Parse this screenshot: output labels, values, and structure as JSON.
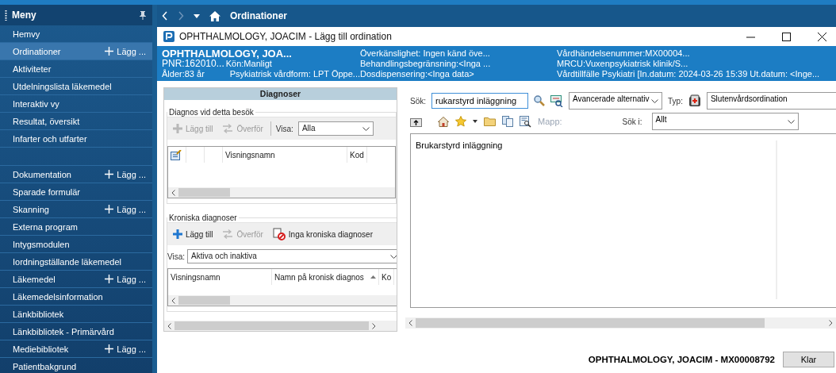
{
  "sidebar": {
    "title": "Meny",
    "groups": [
      [
        {
          "label": "Hemvy",
          "selected": false
        },
        {
          "label": "Ordinationer",
          "selected": true,
          "add_label": "Lägg ..."
        },
        {
          "label": "Aktiviteter",
          "selected": false
        },
        {
          "label": "Utdelningslista läkemedel",
          "selected": false
        },
        {
          "label": "Interaktiv vy",
          "selected": false
        },
        {
          "label": "Resultat, översikt",
          "selected": false
        },
        {
          "label": "Infarter och utfarter",
          "selected": false
        }
      ],
      [
        {
          "label": "Dokumentation",
          "selected": false,
          "add_label": "Lägg ..."
        },
        {
          "label": "Sparade formulär",
          "selected": false
        },
        {
          "label": "Skanning",
          "selected": false,
          "add_label": "Lägg ..."
        },
        {
          "label": "Externa program",
          "selected": false
        },
        {
          "label": "Intygsmodulen",
          "selected": false
        },
        {
          "label": "Iordningställande läkemedel",
          "selected": false
        },
        {
          "label": "Läkemedel",
          "selected": false,
          "add_label": "Lägg ..."
        },
        {
          "label": "Läkemedelsinformation",
          "selected": false
        },
        {
          "label": "Länkbibliotek",
          "selected": false
        },
        {
          "label": "Länkbibliotek - Primärvård",
          "selected": false
        },
        {
          "label": "Mediebibliotek",
          "selected": false,
          "add_label": "Lägg ..."
        },
        {
          "label": "Patientbakgrund",
          "selected": false
        }
      ]
    ]
  },
  "nav": {
    "title": "Ordinationer"
  },
  "dialog": {
    "title": "OPHTHALMOLOGY, JOACIM - Lägg till ordination",
    "patient": {
      "name": "OPHTHALMOLOGY, JOA...",
      "pnr": "PNR:162010...",
      "gender": "Kön:Manligt",
      "age": "Ålder:83 år",
      "care_form": "Psykiatrisk vårdform: LPT Öppe...",
      "allergy": "Överkänslighet: Ingen känd öve...",
      "treatment_limit": "Behandlingsbegränsning:<Inga ...",
      "dose_dispensing": "Dosdispensering:<Inga data>",
      "event_number": "Vårdhändelsenummer:MX00004...",
      "mrcu": "MRCU:Vuxenpsykiatrisk klinik/S...",
      "care_episode": "Vårdtillfälle Psykiatri [In.datum: 2024-03-26 15:39 Ut.datum: <Inge..."
    },
    "diagnoses": {
      "title": "Diagnoser",
      "visit": {
        "legend": "Diagnos vid detta besök",
        "tools": [
          {
            "label": "Lägg till",
            "kind": "add",
            "disabled": true
          },
          {
            "label": "Överför",
            "kind": "transfer",
            "disabled": true
          }
        ],
        "show_label": "Visa:",
        "show_value": "Alla",
        "columns": [
          {
            "label": "Visningsnamn",
            "sorted": false
          },
          {
            "label": "Kod",
            "sorted": false
          }
        ]
      },
      "chronic": {
        "legend": "Kroniska diagnoser",
        "tools": [
          {
            "label": "Lägg till",
            "kind": "add",
            "disabled": false
          },
          {
            "label": "Överför",
            "kind": "transfer",
            "disabled": true
          },
          {
            "label": "Inga kroniska diagnoser",
            "kind": "none",
            "disabled": false
          }
        ],
        "show_label": "Visa:",
        "show_value": "Aktiva och inaktiva",
        "columns": [
          {
            "label": "Visningsnamn",
            "sorted": false
          },
          {
            "label": "Namn på kronisk diagnos",
            "sorted": true
          },
          {
            "label": "Ko",
            "sorted": false
          }
        ]
      }
    },
    "search": {
      "label": "Sök:",
      "value": "rukarstyrd inläggning",
      "advanced": "Avancerade alternativ",
      "type_label": "Typ:",
      "type_value": "Slutenvårdsordination",
      "folder_label": "Mapp:",
      "search_in_label": "Sök i:",
      "search_in_value": "Allt"
    },
    "results": [
      "Brukarstyrd inläggning"
    ],
    "footer": {
      "patient_id": "OPHTHALMOLOGY, JOACIM - MX00008792",
      "button": "Klar"
    }
  }
}
